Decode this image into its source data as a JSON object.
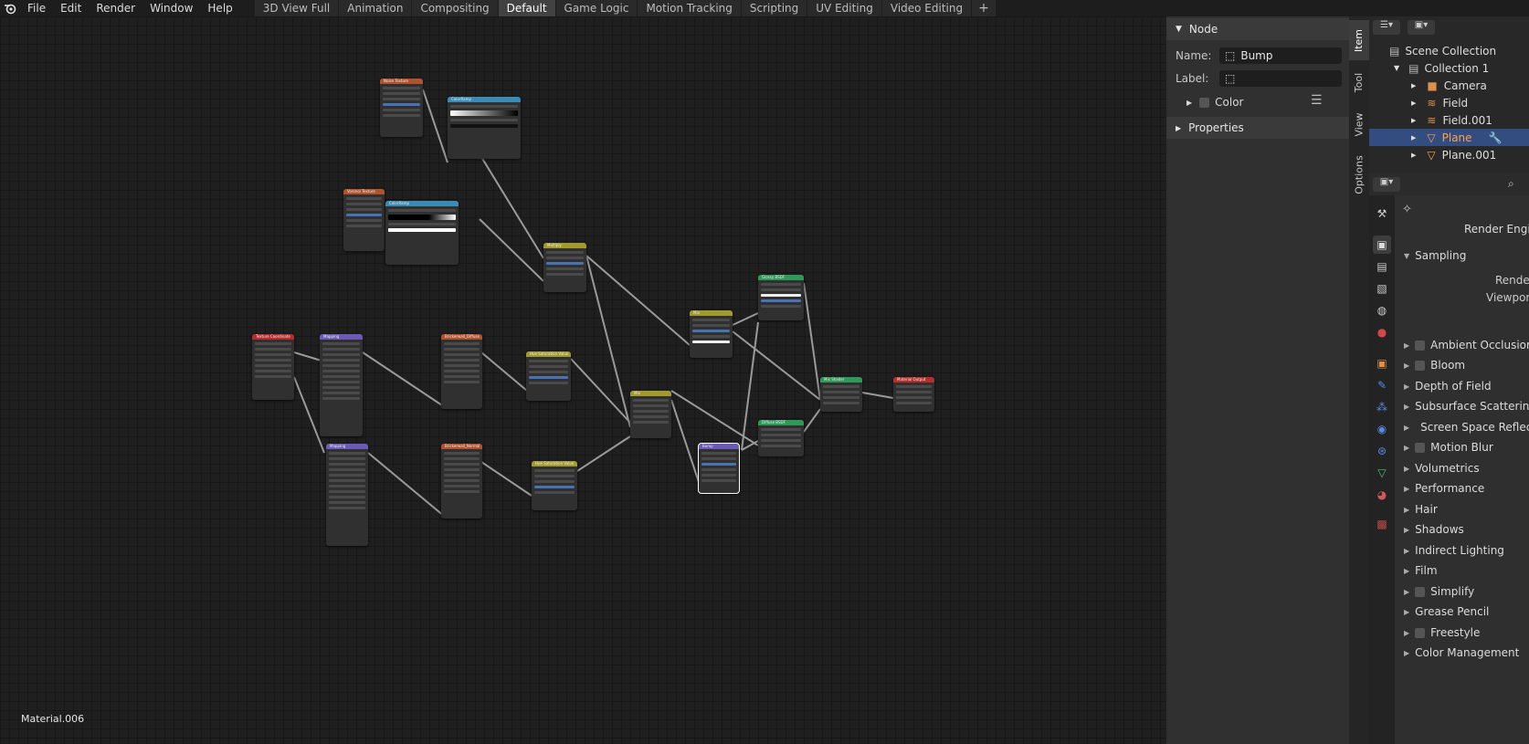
{
  "menu": [
    "File",
    "Edit",
    "Render",
    "Window",
    "Help"
  ],
  "workspaces": [
    "3D View Full",
    "Animation",
    "Compositing",
    "Default",
    "Game Logic",
    "Motion Tracking",
    "Scripting",
    "UV Editing",
    "Video Editing"
  ],
  "active_workspace": "Default",
  "add_tab": "+",
  "node_editor": {
    "material_name": "Material.006",
    "nodes": [
      "Noise Texture",
      "ColorRamp",
      "Voronoi Texture",
      "ColorRamp",
      "Multiply",
      "Texture Coordinate",
      "Mapping",
      "Mapping",
      "Brickerwall_Diffuse",
      "Hue Saturation Value",
      "Brickerwall_Normal",
      "Hue Saturation Value",
      "Mix",
      "Mix",
      "Glossy BSDF",
      "Diffuse BSDF",
      "Bump",
      "Mix Shader",
      "Material Output"
    ]
  },
  "n_panel": {
    "node_section": "Node",
    "name_label": "Name:",
    "name_value": "Bump",
    "label_label": "Label:",
    "label_value": "",
    "color_label": "Color",
    "properties_label": "Properties",
    "tabs": [
      "Item",
      "Tool",
      "View",
      "Options"
    ]
  },
  "outliner": {
    "rows": [
      {
        "label": "Scene Collection",
        "indent": 0
      },
      {
        "label": "Collection 1",
        "indent": 1
      },
      {
        "label": "Camera",
        "indent": 2
      },
      {
        "label": "Field",
        "indent": 2
      },
      {
        "label": "Field.001",
        "indent": 2
      },
      {
        "label": "Plane",
        "indent": 2,
        "selected": true
      },
      {
        "label": "Plane.001",
        "indent": 2
      }
    ]
  },
  "properties": {
    "render_engine_label": "Render Engine",
    "sampling": "Sampling",
    "render_label": "Render",
    "viewport_label": "Viewport",
    "panels": [
      {
        "label": "Ambient Occlusion",
        "checkbox": true
      },
      {
        "label": "Bloom",
        "checkbox": true
      },
      {
        "label": "Depth of Field",
        "checkbox": false
      },
      {
        "label": "Subsurface Scattering",
        "checkbox": false
      },
      {
        "label": "Screen Space Reflections",
        "checkbox": true
      },
      {
        "label": "Motion Blur",
        "checkbox": true
      },
      {
        "label": "Volumetrics",
        "checkbox": false
      },
      {
        "label": "Performance",
        "checkbox": false
      },
      {
        "label": "Hair",
        "checkbox": false
      },
      {
        "label": "Shadows",
        "checkbox": false
      },
      {
        "label": "Indirect Lighting",
        "checkbox": false
      },
      {
        "label": "Film",
        "checkbox": false
      },
      {
        "label": "Simplify",
        "checkbox": true
      },
      {
        "label": "Grease Pencil",
        "checkbox": false
      },
      {
        "label": "Freestyle",
        "checkbox": true
      },
      {
        "label": "Color Management",
        "checkbox": false
      }
    ]
  },
  "colors": {
    "accent": "#4772b3",
    "selected_row": "#334d80",
    "selected_text": "#ffa04a",
    "texture_header": "#b0522e",
    "converter_header": "#3c8bb5",
    "vector_header": "#6b5bb5",
    "color_header": "#a19a2e",
    "shader_header": "#2e9a5a",
    "output_header": "#b52e2e"
  }
}
